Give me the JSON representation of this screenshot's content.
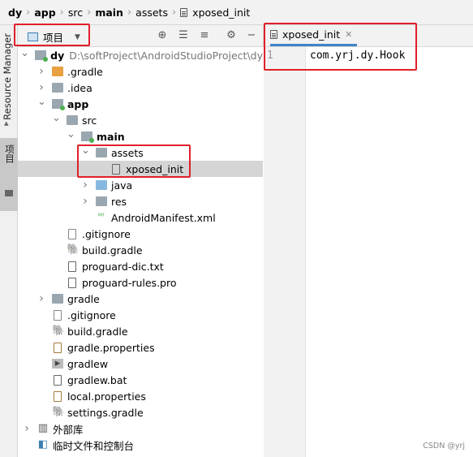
{
  "breadcrumb": [
    "dy",
    "app",
    "src",
    "main",
    "assets",
    "xposed_init"
  ],
  "side_stripe": {
    "resource_manager": "Resource Manager",
    "project": "项目"
  },
  "project_panel": {
    "view_label": "项目",
    "toolbar_icons": [
      "crosshair-icon",
      "expand-all-icon",
      "collapse-all-icon",
      "gear-icon",
      "minimize-icon"
    ]
  },
  "tree": [
    {
      "label": "dy",
      "extra": "D:\\softProject\\AndroidStudioProject\\dy",
      "depth": 0,
      "expanded": true,
      "icon": "module-icon",
      "bold": true
    },
    {
      "label": ".gradle",
      "depth": 1,
      "expanded": false,
      "icon": "folder-orange-icon"
    },
    {
      "label": ".idea",
      "depth": 1,
      "expanded": false,
      "icon": "folder-icon"
    },
    {
      "label": "app",
      "depth": 1,
      "expanded": true,
      "icon": "module-icon",
      "bold": true
    },
    {
      "label": "src",
      "depth": 2,
      "expanded": true,
      "icon": "folder-icon"
    },
    {
      "label": "main",
      "depth": 3,
      "expanded": true,
      "icon": "module-icon",
      "bold": true
    },
    {
      "label": "assets",
      "depth": 4,
      "expanded": true,
      "icon": "folder-res-icon"
    },
    {
      "label": "xposed_init",
      "depth": 5,
      "leaf": true,
      "icon": "file-icon",
      "selected": true
    },
    {
      "label": "java",
      "depth": 4,
      "expanded": false,
      "icon": "folder-blue-icon"
    },
    {
      "label": "res",
      "depth": 4,
      "expanded": false,
      "icon": "folder-res-icon"
    },
    {
      "label": "AndroidManifest.xml",
      "depth": 4,
      "leaf": true,
      "icon": "manifest-icon"
    },
    {
      "label": ".gitignore",
      "depth": 2,
      "leaf": true,
      "icon": "gitignore-icon"
    },
    {
      "label": "build.gradle",
      "depth": 2,
      "leaf": true,
      "icon": "gradle-icon"
    },
    {
      "label": "proguard-dic.txt",
      "depth": 2,
      "leaf": true,
      "icon": "file-icon"
    },
    {
      "label": "proguard-rules.pro",
      "depth": 2,
      "leaf": true,
      "icon": "file-icon"
    },
    {
      "label": "gradle",
      "depth": 1,
      "expanded": false,
      "icon": "folder-icon"
    },
    {
      "label": ".gitignore",
      "depth": 1,
      "leaf": true,
      "icon": "gitignore-icon"
    },
    {
      "label": "build.gradle",
      "depth": 1,
      "leaf": true,
      "icon": "gradle-icon"
    },
    {
      "label": "gradle.properties",
      "depth": 1,
      "leaf": true,
      "icon": "properties-icon"
    },
    {
      "label": "gradlew",
      "depth": 1,
      "leaf": true,
      "icon": "script-icon"
    },
    {
      "label": "gradlew.bat",
      "depth": 1,
      "leaf": true,
      "icon": "file-icon"
    },
    {
      "label": "local.properties",
      "depth": 1,
      "leaf": true,
      "icon": "properties-icon"
    },
    {
      "label": "settings.gradle",
      "depth": 1,
      "leaf": true,
      "icon": "gradle-icon"
    },
    {
      "label": "外部库",
      "depth": 0,
      "expanded": false,
      "icon": "library-icon"
    },
    {
      "label": "临时文件和控制台",
      "depth": 0,
      "leaf": true,
      "icon": "scratches-icon"
    }
  ],
  "editor": {
    "tab_label": "xposed_init",
    "line_number": "1",
    "code": "com.yrj.dy.Hook"
  },
  "watermark": "CSDN @yrj",
  "colors": {
    "highlight_box": "#e0202a",
    "tab_underline": "#4083c9",
    "selection": "#d5d5d5"
  }
}
